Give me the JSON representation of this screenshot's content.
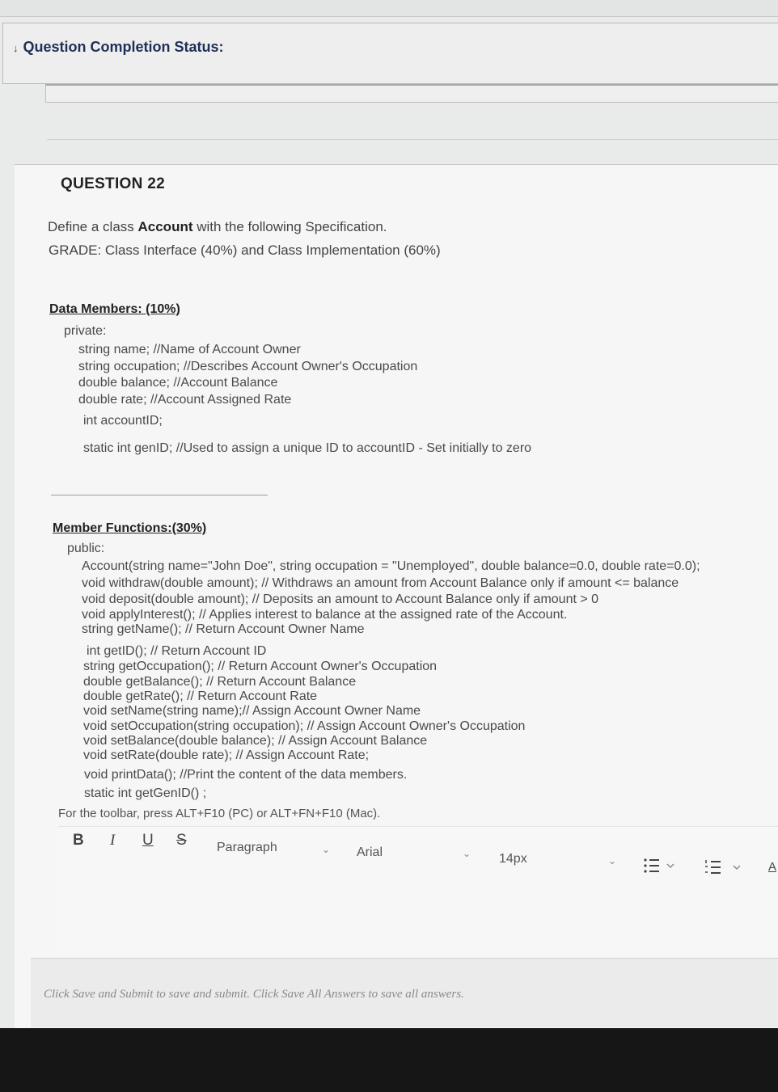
{
  "status": {
    "title": "Question Completion Status:"
  },
  "question": {
    "number_label": "QUESTION 22",
    "intro_prefix": "Define a class ",
    "intro_class": "Account",
    "intro_suffix": " with the following Specification.",
    "grade_line": "GRADE: Class Interface (40%) and Class Implementation (60%)",
    "data_members": {
      "heading": "Data Members: (10%)",
      "access": "private:",
      "lines": [
        "string name; //Name of Account Owner",
        "string occupation; //Describes Account Owner's Occupation",
        "double balance; //Account Balance",
        "double rate; //Account Assigned Rate",
        "int accountID;",
        "static int genID; //Used to assign a unique ID to accountID - Set initially to zero"
      ]
    },
    "member_functions": {
      "heading": "Member Functions:(30%)",
      "access": "public:",
      "lines": [
        "Account(string name=\"John Doe\", string occupation = \"Unemployed\", double balance=0.0, double rate=0.0);",
        "void withdraw(double amount); // Withdraws an amount from Account Balance only if amount <= balance",
        "void deposit(double amount); // Deposits an amount to Account Balance only if amount > 0",
        "void applyInterest(); // Applies interest to balance at the assigned rate of the Account.",
        "string getName(); // Return Account Owner Name",
        "int getID(); // Return Account ID",
        "string getOccupation(); // Return Account Owner's Occupation",
        "double getBalance(); // Return Account Balance",
        "double getRate(); // Return Account Rate",
        "void setName(string name);// Assign Account Owner Name",
        "void setOccupation(string occupation); // Assign Account Owner's Occupation",
        "void setBalance(double balance); // Assign Account Balance",
        "void setRate(double rate); // Assign Account Rate;",
        "void printData(); //Print the content of the data members.",
        "static int getGenID() ;"
      ]
    }
  },
  "editor": {
    "toolbar_hint": "For the toolbar, press ALT+F10 (PC) or ALT+FN+F10 (Mac).",
    "bold": "B",
    "italic": "I",
    "underline": "U",
    "strike": "S",
    "format_value": "Paragraph",
    "font_value": "Arial",
    "size_value": "14px",
    "text_color_label": "A"
  },
  "footer": {
    "instructions": "Click Save and Submit to save and submit. Click Save All Answers to save all answers."
  },
  "icons": [
    "chevron-down-icon",
    "caret-down-icon",
    "bullet-list-icon",
    "numbered-list-icon"
  ]
}
